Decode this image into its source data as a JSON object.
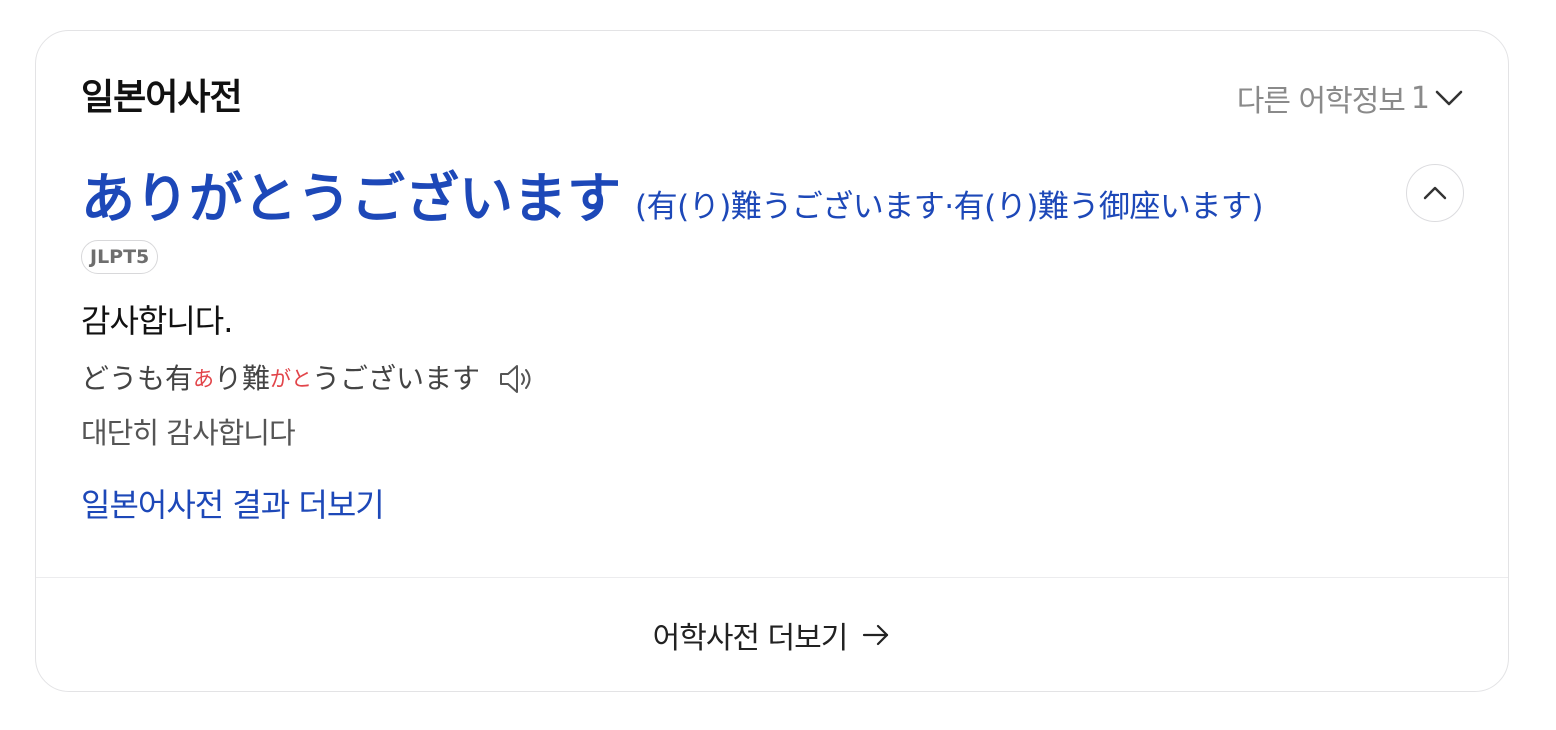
{
  "card": {
    "title": "일본어사전",
    "more_info_label": "다른 어학정보",
    "more_info_count": "1"
  },
  "entry": {
    "headword": "ありがとうございます",
    "kanji_forms": "(有(り)難うございます·有(り)難う御座います)",
    "badge": "JLPT5",
    "meaning": "감사합니다.",
    "example": {
      "segments": [
        {
          "text": "どうも有",
          "ruby": false
        },
        {
          "text": "あ",
          "ruby": true
        },
        {
          "text": "り難",
          "ruby": false
        },
        {
          "text": "がと",
          "ruby": true
        },
        {
          "text": "うございます",
          "ruby": false
        }
      ]
    },
    "translation": "대단히 감사합니다"
  },
  "links": {
    "result_more": "일본어사전 결과 더보기",
    "footer_more": "어학사전 더보기"
  },
  "icons": {
    "more_info": "chevron-down-icon",
    "collapse": "chevron-up-icon",
    "speaker": "speaker-icon",
    "footer": "arrow-right-icon"
  },
  "colors": {
    "accent": "#1d48b8",
    "ruby": "#e2454a",
    "muted": "#8a8a8a"
  }
}
